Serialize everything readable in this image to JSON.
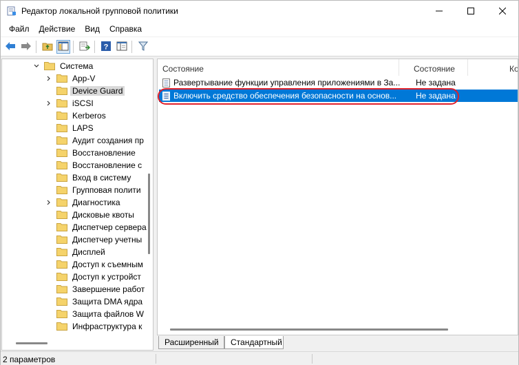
{
  "window": {
    "title": "Редактор локальной групповой политики",
    "controls": [
      "minimize-icon",
      "maximize-icon",
      "close-icon"
    ]
  },
  "menu": [
    "Файл",
    "Действие",
    "Вид",
    "Справка"
  ],
  "toolbar": {
    "buttons": [
      "back-arrow-icon",
      "forward-arrow-icon",
      "up-folder-icon",
      "show-hide-tree-icon",
      "export-list-icon",
      "help-icon",
      "properties-icon",
      "filter-icon"
    ]
  },
  "tree": {
    "parent": "Система",
    "items": [
      {
        "label": "App-V",
        "expandable": true
      },
      {
        "label": "Device Guard",
        "expandable": false,
        "selected": true
      },
      {
        "label": "iSCSI",
        "expandable": true
      },
      {
        "label": "Kerberos",
        "expandable": false
      },
      {
        "label": "LAPS",
        "expandable": false
      },
      {
        "label": "Аудит создания пр",
        "expandable": false
      },
      {
        "label": "Восстановление",
        "expandable": false
      },
      {
        "label": "Восстановление с",
        "expandable": false
      },
      {
        "label": "Вход в систему",
        "expandable": false
      },
      {
        "label": "Групповая полити",
        "expandable": false
      },
      {
        "label": "Диагностика",
        "expandable": true
      },
      {
        "label": "Дисковые квоты",
        "expandable": false
      },
      {
        "label": "Диспетчер сервера",
        "expandable": false
      },
      {
        "label": "Диспетчер учетны",
        "expandable": false
      },
      {
        "label": "Дисплей",
        "expandable": false
      },
      {
        "label": "Доступ к съемным",
        "expandable": false
      },
      {
        "label": "Доступ к устройст",
        "expandable": false
      },
      {
        "label": "Завершение работ",
        "expandable": false
      },
      {
        "label": "Защита DMA ядра",
        "expandable": false
      },
      {
        "label": "Защита файлов W",
        "expandable": false
      },
      {
        "label": "Инфраструктура к",
        "expandable": false
      }
    ]
  },
  "list": {
    "columns": [
      "Состояние",
      "Состояние",
      "Ко"
    ],
    "rows": [
      {
        "name": "Развертывание функции управления приложениями в За...",
        "state": "Не задана",
        "selected": false
      },
      {
        "name": "Включить средство обеспечения безопасности на основ...",
        "state": "Не задана",
        "selected": true
      }
    ]
  },
  "tabs": [
    "Расширенный",
    "Стандартный"
  ],
  "status": {
    "text": "2 параметров"
  },
  "colors": {
    "selection": "#0078d7",
    "highlight_ellipse": "#e0202a"
  }
}
